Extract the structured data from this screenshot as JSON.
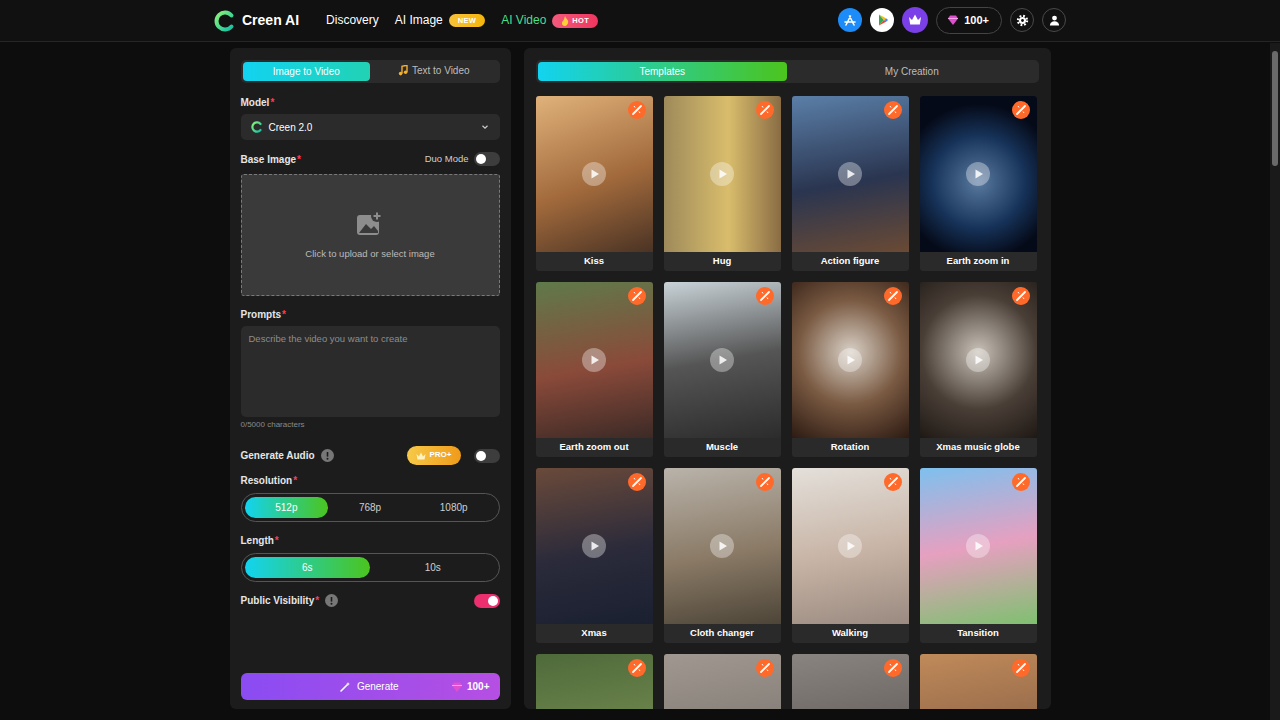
{
  "brand": {
    "name": "Creen AI"
  },
  "nav": [
    {
      "label": "Discovery",
      "selected": false
    },
    {
      "label": "AI Image",
      "selected": false,
      "badge": {
        "text": "NEW",
        "color": "#f5b50c",
        "kind": "new"
      }
    },
    {
      "label": "AI Video",
      "selected": true,
      "badge": {
        "text": "HOT",
        "color": "#f0365f",
        "kind": "hot"
      }
    }
  ],
  "header": {
    "credits": "100+"
  },
  "mode_tabs": [
    {
      "label": "Image to Video",
      "selected": true,
      "kind": "plain"
    },
    {
      "label": "Text to Video",
      "selected": false,
      "kind": "note"
    }
  ],
  "form": {
    "model": {
      "label": "Model",
      "required": "*",
      "value": "Creen 2.0"
    },
    "base_image": {
      "label": "Base Image",
      "required": "*",
      "duo_mode": {
        "label": "Duo Mode",
        "on": false
      },
      "upload_text": "Click to upload or select image"
    },
    "prompts": {
      "label": "Prompts",
      "required": "*",
      "placeholder": "Describe the video you want to create",
      "counter": "0/5000 characters"
    },
    "generate_audio": {
      "label": "Generate Audio",
      "badge": "PRO+",
      "on": false
    },
    "resolution": {
      "label": "Resolution",
      "required": "*",
      "options": [
        {
          "label": "512p",
          "selected": true
        },
        {
          "label": "768p",
          "selected": false
        },
        {
          "label": "1080p",
          "selected": false
        }
      ]
    },
    "length": {
      "label": "Length",
      "required": "*",
      "options": [
        {
          "label": "6s",
          "selected": true
        },
        {
          "label": "10s",
          "selected": false
        }
      ]
    },
    "public_visibility": {
      "label": "Public Visibility",
      "required": "*",
      "on": true
    }
  },
  "generate_button": {
    "label": "Generate",
    "cost": "100+"
  },
  "content_tabs": [
    {
      "label": "Templates",
      "selected": true
    },
    {
      "label": "My Creation",
      "selected": false
    }
  ],
  "templates": [
    {
      "label": "Kiss",
      "kind": "full"
    },
    {
      "label": "Hug",
      "kind": "full"
    },
    {
      "label": "Action figure",
      "kind": "full"
    },
    {
      "label": "Earth zoom in",
      "kind": "full"
    },
    {
      "label": "Earth zoom out",
      "kind": "full"
    },
    {
      "label": "Muscle",
      "kind": "full"
    },
    {
      "label": "Rotation",
      "kind": "full"
    },
    {
      "label": "Xmas music globe",
      "kind": "full"
    },
    {
      "label": "Xmas",
      "kind": "full"
    },
    {
      "label": "Cloth changer",
      "kind": "full"
    },
    {
      "label": "Walking",
      "kind": "full"
    },
    {
      "label": "Tansition",
      "kind": "full"
    },
    {
      "kind": "partial"
    },
    {
      "kind": "partial"
    },
    {
      "kind": "partial"
    },
    {
      "kind": "partial"
    }
  ]
}
